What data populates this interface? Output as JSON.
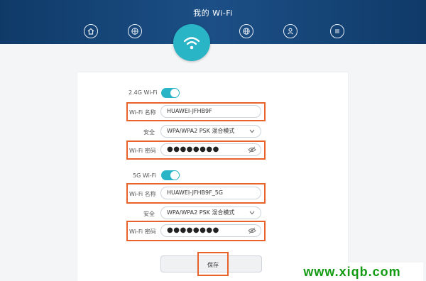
{
  "header": {
    "title": "我的 Wi-Fi"
  },
  "nav": {
    "icons": [
      "home-icon",
      "globe-icon",
      "wifi-icon",
      "globe-network-icon",
      "user-icon",
      "menu-icon"
    ],
    "active": "wifi-icon",
    "accent": "#2ab5c7",
    "header_color": "#1c4f86"
  },
  "wifi24": {
    "band_label": "2.4G Wi-Fi",
    "enabled": true,
    "name_label": "Wi-Fi 名称",
    "name_value": "HUAWEI-JFHB9F",
    "security_label": "安全",
    "security_value": "WPA/WPA2 PSK 混合模式",
    "password_label": "Wi-Fi 密码",
    "password_value": "●●●●●●●●"
  },
  "wifi5": {
    "band_label": "5G Wi-Fi",
    "enabled": true,
    "name_label": "Wi-Fi 名称",
    "name_value": "HUAWEI-JFHB9F_5G",
    "security_label": "安全",
    "security_value": "WPA/WPA2 PSK 混合模式",
    "password_label": "Wi-Fi 密码",
    "password_value": "●●●●●●●●"
  },
  "save_label": "保存",
  "highlight_color": "#e8632b",
  "watermark": "www.xiqb.com"
}
